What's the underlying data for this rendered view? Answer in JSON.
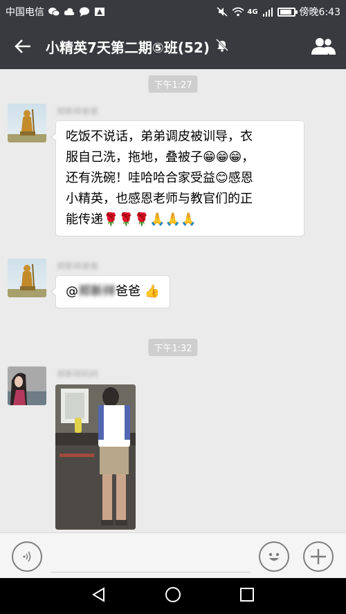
{
  "status_bar": {
    "carrier": "中国电信",
    "network": "4G",
    "time": "傍晚6:43",
    "icons": [
      "wechat-icon",
      "cloud-icon",
      "message-icon",
      "alert-icon",
      "mute-icon",
      "wifi-icon",
      "signal-icon",
      "battery-icon"
    ]
  },
  "header": {
    "title": "小精英7天第二期⑤班(52)",
    "icons": [
      "back-arrow-icon",
      "mute-bell-icon",
      "group-members-icon"
    ]
  },
  "messages": [
    {
      "type": "time",
      "text": "下午1:27"
    },
    {
      "type": "text",
      "sender": "郑新祥爸爸",
      "avatar": "buddha-statue-avatar",
      "lines": [
        "吃饭不说话，弟弟调皮被训导，衣",
        "服自己洗，拖地，叠被子😁😁😁，",
        "还有洗碗！哇哈哈合家受益😊感恩",
        "小精英，也感恩老师与教官们的正",
        "能传递🌹🌹🌹🙏🙏🙏"
      ]
    },
    {
      "type": "text",
      "sender": "郑新祥爸爸",
      "avatar": "buddha-statue-avatar",
      "mention_prefix": "@",
      "mention_name": "郑新祥",
      "mention_suffix": "爸爸 👍"
    },
    {
      "type": "time",
      "text": "下午1:32"
    },
    {
      "type": "image",
      "sender": "郑新祥妈妈",
      "avatar": "woman-avatar",
      "image": "child-washing-dishes-photo"
    }
  ],
  "input_bar": {
    "icons": [
      "voice-icon",
      "emoji-icon",
      "plus-icon"
    ]
  },
  "android_nav": {
    "icons": [
      "back-triangle-icon",
      "home-circle-icon",
      "recents-square-icon"
    ]
  },
  "colors": {
    "header_bg": "#393a3f",
    "chat_bg": "#ebebeb",
    "bubble_bg": "#ffffff",
    "time_bg": "#cecece"
  }
}
